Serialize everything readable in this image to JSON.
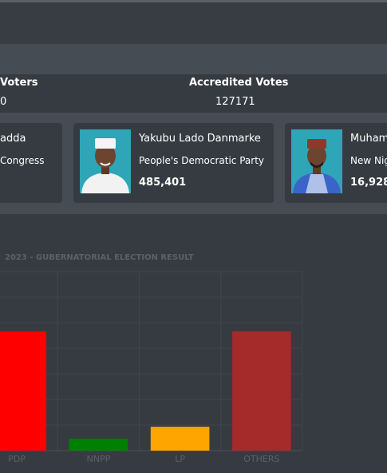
{
  "stats": {
    "registered_label": "Voters",
    "registered_value": "0",
    "accredited_label": "Accredited Votes",
    "accredited_value": "127171"
  },
  "candidates": [
    {
      "name": "adda",
      "party": "Congress",
      "votes": ""
    },
    {
      "name": "Yakubu Lado Danmarke",
      "party": "People's Democratic Party",
      "votes": "485,401"
    },
    {
      "name": "Muham",
      "party": "New Nig",
      "votes": "16,928"
    }
  ],
  "chart_data": {
    "type": "bar",
    "title": "2023 - GUBERNATORIAL ELECTION RESULT",
    "categories": [
      "PDP",
      "NNPP",
      "LP",
      "OTHERS"
    ],
    "values": [
      100,
      10,
      20,
      100
    ],
    "colors": [
      "#ff0000",
      "#008000",
      "#ffa500",
      "#a52a2a"
    ],
    "ylim": [
      0,
      150
    ],
    "grid": true
  }
}
